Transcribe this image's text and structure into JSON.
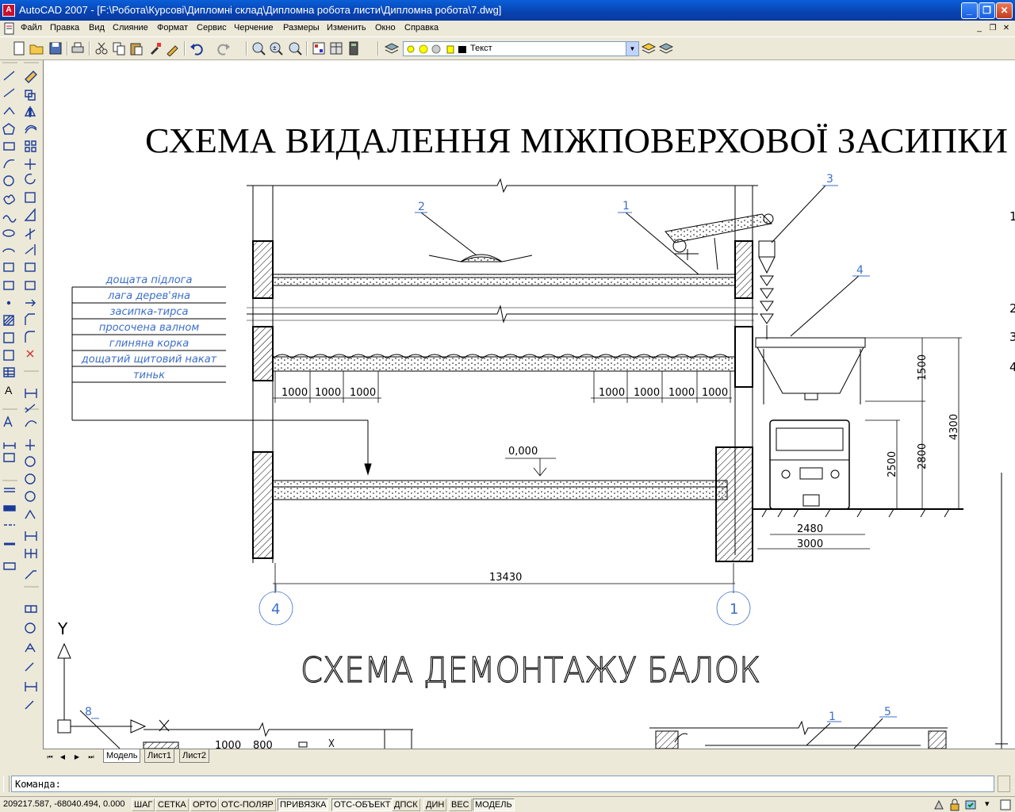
{
  "window": {
    "title": "AutoCAD 2007 - [F:\\Робота\\Курсові\\Дипломні склад\\Дипломна робота листи\\Дипломна робота\\7.dwg]",
    "app_icon": "A"
  },
  "menu": {
    "items": [
      "Файл",
      "Правка",
      "Вид",
      "Слияние",
      "Формат",
      "Сервис",
      "Черчение",
      "Размеры",
      "Изменить",
      "Окно",
      "Справка"
    ]
  },
  "toolbar": {
    "layer_name": "Текст"
  },
  "drawing": {
    "title_top": "СХЕМА ВИДАЛЕННЯ МІЖПОВЕРХОВОЇ ЗАСИПКИ",
    "title_bottom": "СХЕМА ДЕМОНТАЖУ БАЛОК",
    "legend": [
      "дощата підлога",
      "лага дерев'яна",
      "засипка-тирса",
      "просочена валном",
      "глиняна корка",
      "дощатий щитовий накат",
      "тиньк"
    ],
    "callouts": {
      "c1": "1",
      "c2": "2",
      "c3": "3",
      "c4": "4",
      "c5": "5",
      "c8": "8",
      "c1b": "1"
    },
    "dims": {
      "d1000": "1000",
      "level": "0,000",
      "span": "13430",
      "h1500": "1500",
      "h4300": "4300",
      "h2500": "2500",
      "h2800": "2800",
      "w2480": "2480",
      "w3000": "3000",
      "d800": "800"
    },
    "axes": {
      "left": "4",
      "right": "1"
    },
    "ucs_y": "Y",
    "edge_numbers": {
      "n1": "1",
      "n2": "2",
      "n3": "3",
      "n4": "4"
    }
  },
  "tabs": [
    "Модель",
    "Лист1",
    "Лист2"
  ],
  "command": {
    "prompt": "Команда:"
  },
  "status": {
    "coords": "209217.587, -68040.494, 0.000",
    "buttons": [
      "ШАГ",
      "СЕТКА",
      "ОРТО",
      "ОТС-ПОЛЯР",
      "ПРИВЯЗКА",
      "ОТС-ОБЪЕКТ",
      "ДПСК",
      "ДИН",
      "ВЕС",
      "МОДЕЛЬ"
    ]
  },
  "colors": {
    "drawing_blue": "#3c6ec8",
    "titlebar": "#0a5fd8"
  }
}
